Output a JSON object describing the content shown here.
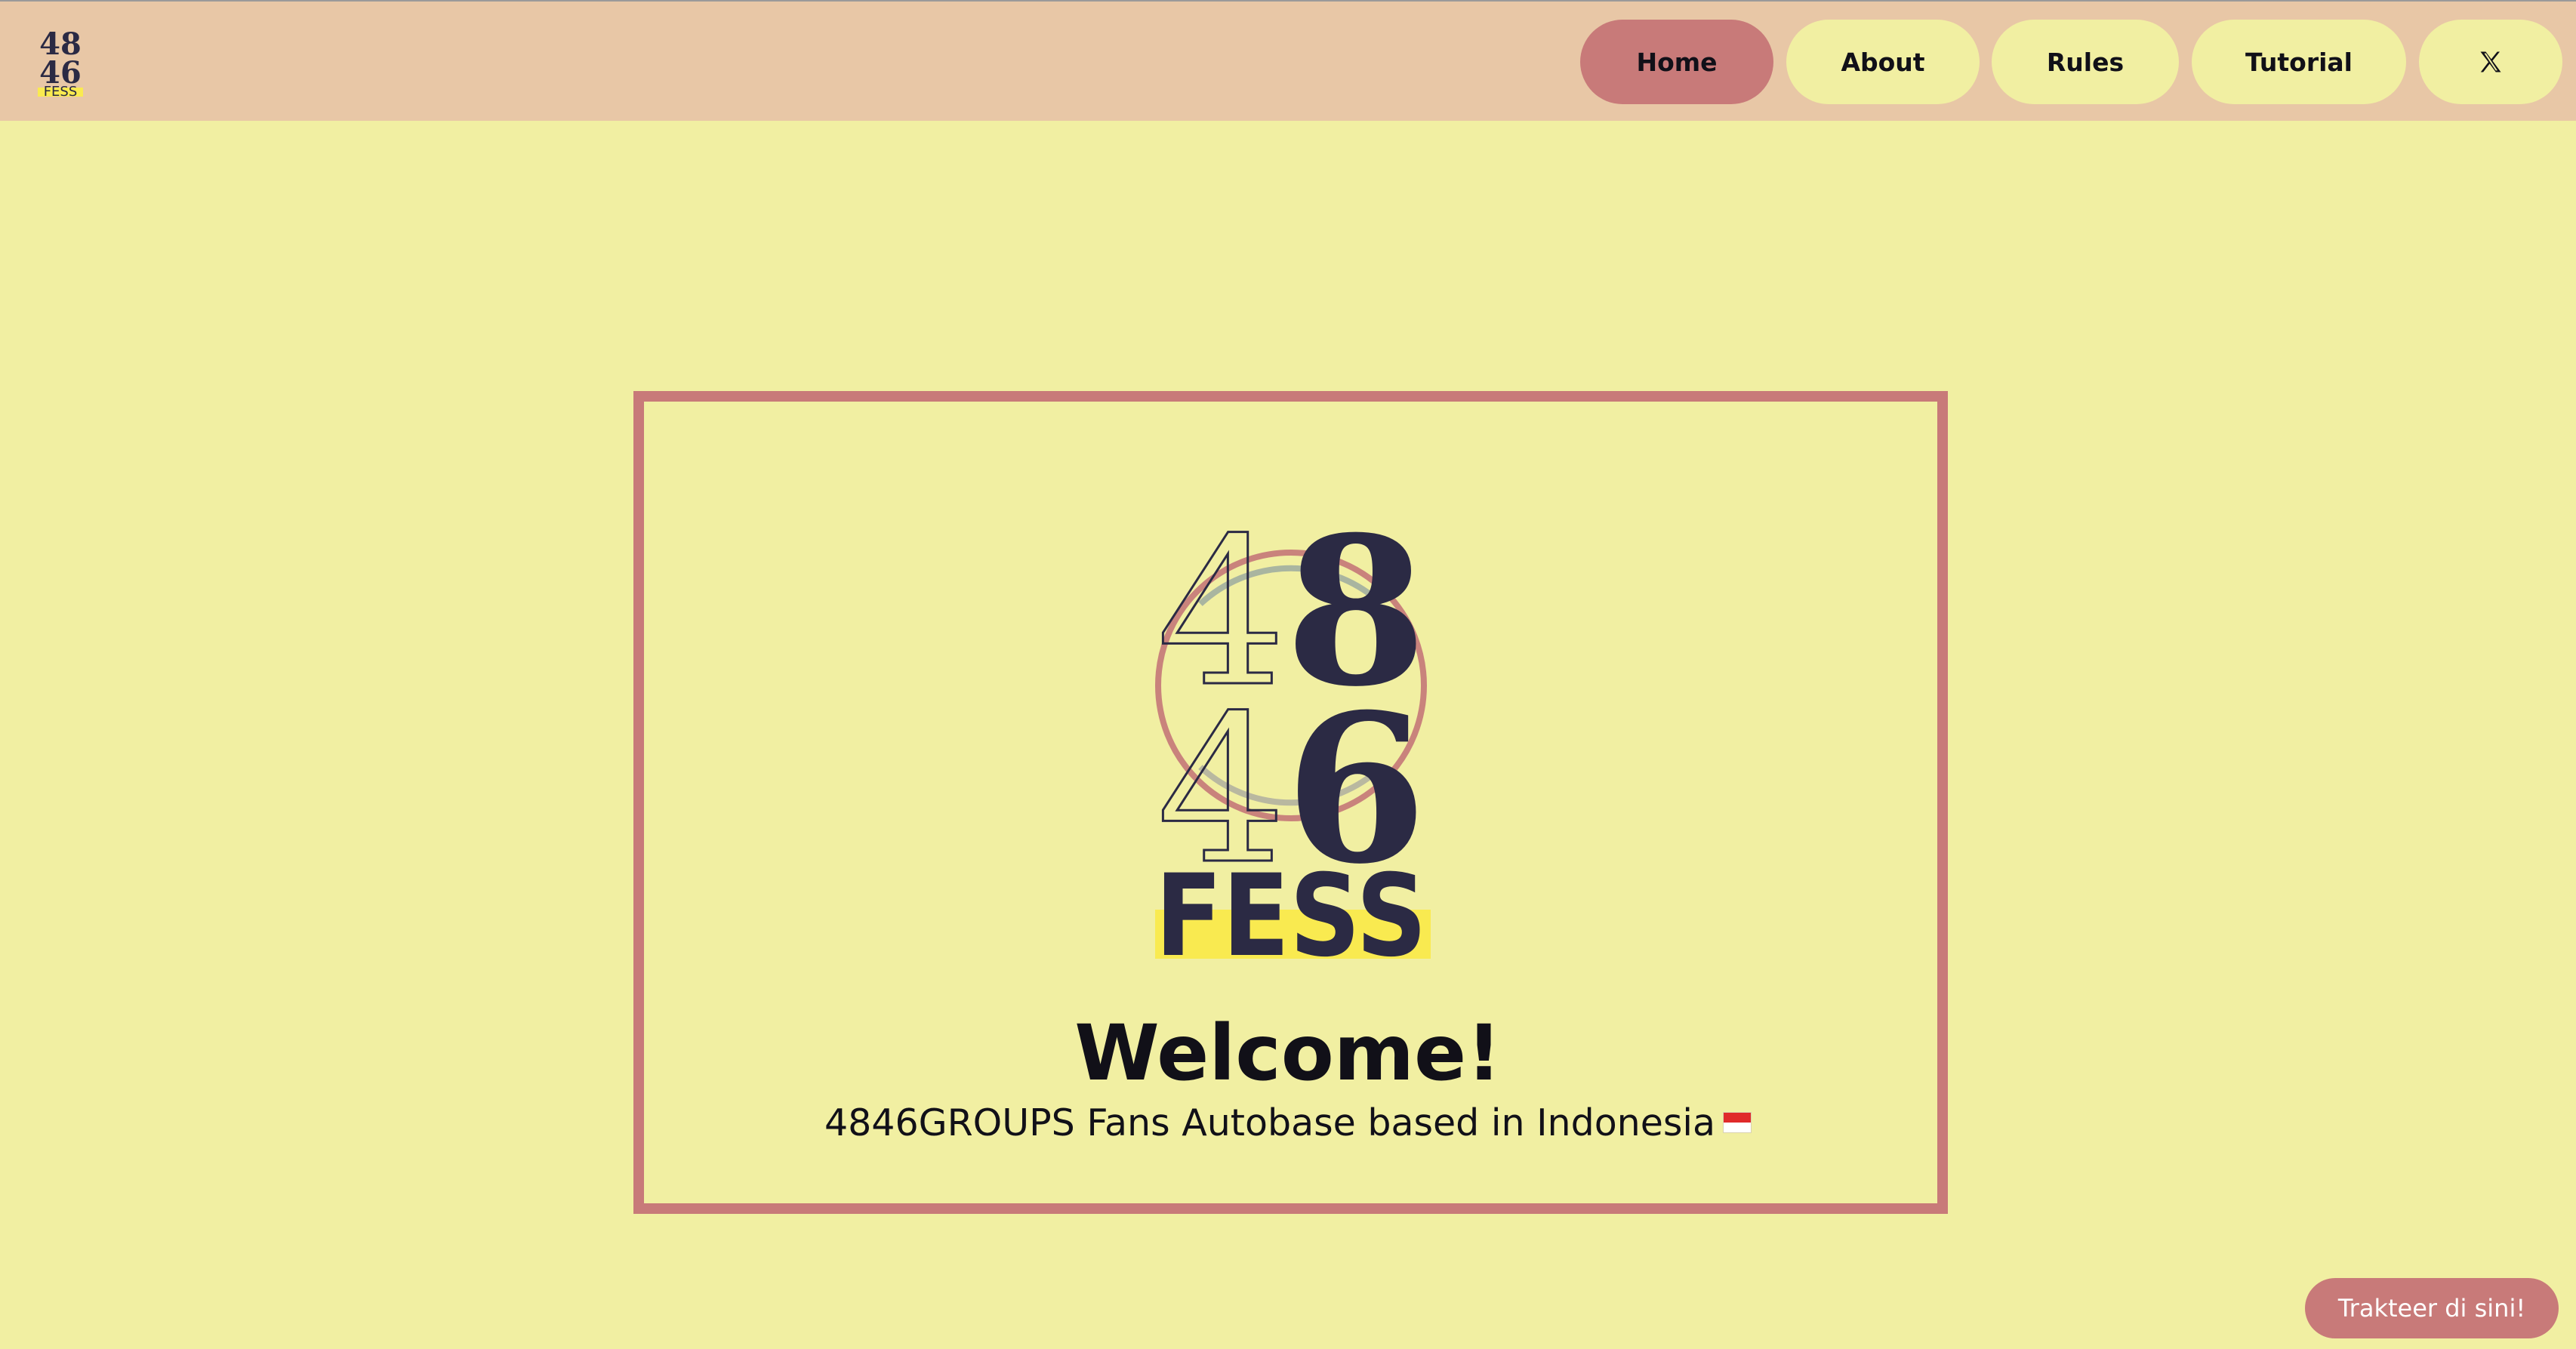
{
  "nav": {
    "logo_icon": "4846fess-logo",
    "items": [
      {
        "label": "Home",
        "active": true
      },
      {
        "label": "About",
        "active": false
      },
      {
        "label": "Rules",
        "active": false
      },
      {
        "label": "Tutorial",
        "active": false
      }
    ],
    "x_icon": "x-twitter-icon"
  },
  "hero": {
    "logo": {
      "line1": "48",
      "line2": "46",
      "line3": "FESS"
    },
    "title": "Welcome!",
    "subtitle": "4846GROUPS Fans Autobase based in Indonesia",
    "flag_icon": "indonesia-flag-icon"
  },
  "cta": {
    "label": "Trakteer di sini!"
  },
  "colors": {
    "background": "#f1efa2",
    "navbar": "#e8c7a6",
    "accent": "#c87a79",
    "logo_dark": "#2b2a44",
    "logo_highlight": "#f9ea50"
  }
}
